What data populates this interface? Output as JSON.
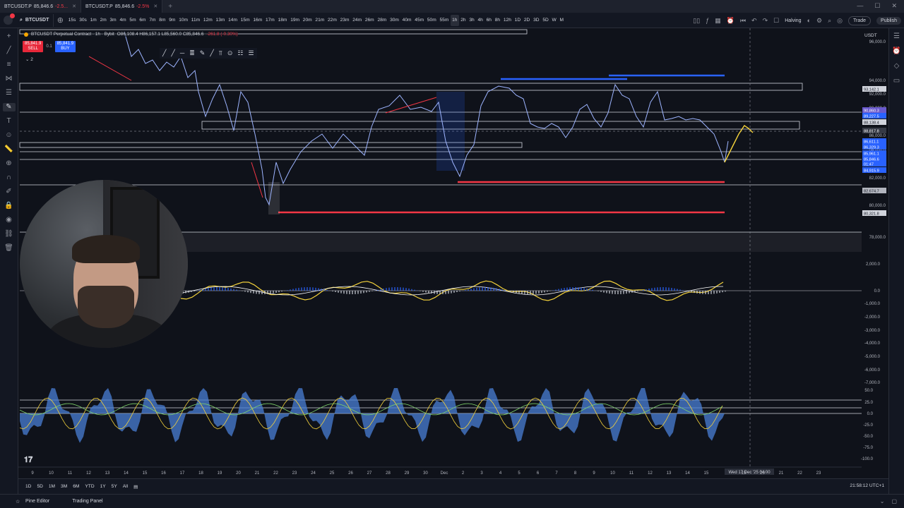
{
  "tabs": [
    {
      "symbol": "BTCUSDT.P",
      "price": "85,846.6",
      "change": "-2.5...",
      "active": false
    },
    {
      "symbol": "BTCUSDT.P",
      "price": "85,846.6",
      "change": "-2.5%",
      "active": true
    }
  ],
  "toolbar": {
    "symbol": "BTCUSDT",
    "intervals": [
      "15s",
      "30s",
      "1m",
      "2m",
      "3m",
      "4m",
      "5m",
      "6m",
      "7m",
      "8m",
      "9m",
      "10m",
      "11m",
      "12m",
      "13m",
      "14m",
      "15m",
      "16m",
      "17m",
      "18m",
      "19m",
      "20m",
      "21m",
      "22m",
      "23m",
      "24m",
      "26m",
      "28m",
      "30m",
      "40m",
      "45m",
      "50m",
      "55m",
      "1h",
      "2h",
      "3h",
      "4h",
      "6h",
      "8h",
      "12h",
      "1D",
      "2D",
      "3D",
      "5D",
      "W",
      "M"
    ],
    "selected_interval": "1h",
    "halving_label": "Halving",
    "trade_label": "Trade",
    "publish_label": "Publish"
  },
  "legend": {
    "title": "BTCUSDT Perpetual Contract · 1h · Bybit",
    "ohlc": "O86,108.4 H86,157.1 L85,560.0 C85,846.6",
    "change": "-261.8 (-0.30%)",
    "sell_price": "85,841.9",
    "sell_label": "SELL",
    "spread": "0.1",
    "buy_price": "85,841.9",
    "buy_label": "BUY",
    "indicator_count": "2"
  },
  "price_axis": {
    "currency": "USDT",
    "ticks": [
      "96,000.0",
      "94,000.0",
      "92,000.0",
      "90,000.0",
      "88,000.0",
      "86,000.0",
      "84,000.0",
      "82,000.0",
      "80,000.0",
      "78,000.0"
    ],
    "tags": [
      {
        "label": "93,142.1",
        "color": "#d1d4dc",
        "text": "#131722"
      },
      {
        "label": "90,860.3",
        "color": "#6a5acd",
        "text": "#ffffff"
      },
      {
        "label": "89,227.5",
        "color": "#2962ff",
        "text": "#ffffff"
      },
      {
        "label": "88,138.4",
        "color": "#d1d4dc",
        "text": "#131722"
      },
      {
        "label": "88,817.8",
        "color": "#363a45",
        "text": "#ffffff"
      },
      {
        "label": "86,611.1",
        "color": "#2962ff",
        "text": "#ffffff"
      },
      {
        "label": "86,329.3",
        "color": "#2962ff",
        "text": "#ffffff"
      },
      {
        "label": "85,961.1",
        "color": "#2962ff",
        "text": "#ffffff"
      },
      {
        "label": "85,846.6",
        "color": "#2962ff",
        "text": "#ffffff"
      },
      {
        "label": "01:47",
        "color": "#2962ff",
        "text": "#ffffff"
      },
      {
        "label": "84,915.9",
        "color": "#2962ff",
        "text": "#ffffff"
      },
      {
        "label": "82,674.7",
        "color": "#b2b5be",
        "text": "#131722"
      },
      {
        "label": "80,321.8",
        "color": "#d1d4dc",
        "text": "#131722"
      }
    ]
  },
  "osc1_axis": [
    "2,000.0",
    "0.0",
    "-1,000.0",
    "-2,000.0",
    "-3,000.0",
    "-4,000.0",
    "-5,000.0",
    "-6,000.0",
    "-7,000.0"
  ],
  "osc2_axis": [
    "50.0",
    "25.0",
    "0.0",
    "-25.0",
    "-50.0",
    "-75.0",
    "-100.0"
  ],
  "time_axis": [
    "9",
    "10",
    "11",
    "12",
    "13",
    "14",
    "15",
    "16",
    "17",
    "18",
    "19",
    "20",
    "21",
    "22",
    "23",
    "24",
    "25",
    "26",
    "27",
    "28",
    "29",
    "30",
    "Dec",
    "2",
    "3",
    "4",
    "5",
    "6",
    "7",
    "8",
    "9",
    "10",
    "11",
    "12",
    "13",
    "14",
    "15",
    "Wed 17 Dec '25",
    "19",
    "20",
    "21",
    "22",
    "23"
  ],
  "crosshair_time": "Wed 17 Dec '25  04:00",
  "bottom": {
    "ranges": [
      "1D",
      "5D",
      "1M",
      "3M",
      "6M",
      "YTD",
      "1Y",
      "5Y",
      "All"
    ],
    "clock": "21:58:12 UTC+1",
    "pine_editor": "Pine Editor",
    "trading_panel": "Trading Panel"
  },
  "colors": {
    "background": "#0f121a",
    "candle": "#9db4ff",
    "support": "#f23645",
    "resistance": "#2962ff",
    "signal": "#f5d33b"
  }
}
